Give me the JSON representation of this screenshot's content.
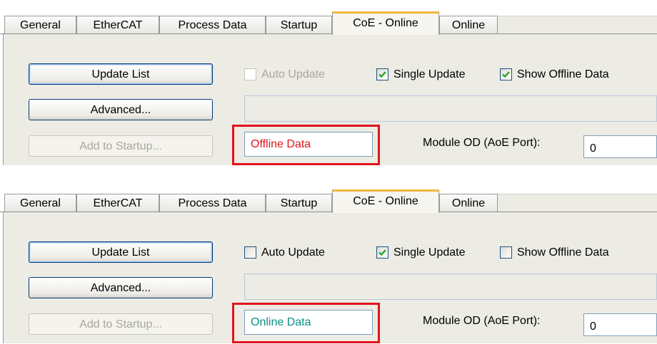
{
  "colors": {
    "offline_text": "#e0141c",
    "online_text": "#0a8c86",
    "highlight": "#e0141c",
    "active_tab_accent": "#f4b73d"
  },
  "panels": [
    {
      "tabs": [
        "General",
        "EtherCAT",
        "Process Data",
        "Startup",
        "CoE - Online",
        "Online"
      ],
      "active_tab": "CoE - Online",
      "buttons": {
        "update_list": "Update List",
        "advanced": "Advanced...",
        "add_to_startup": "Add to Startup..."
      },
      "checkboxes": {
        "auto_update": {
          "label": "Auto Update",
          "checked": false,
          "enabled": false
        },
        "single_update": {
          "label": "Single Update",
          "checked": true,
          "enabled": true
        },
        "show_offline_data": {
          "label": "Show Offline Data",
          "checked": true,
          "enabled": true
        }
      },
      "status_field": "Offline Data",
      "module_od_label": "Module OD (AoE Port):",
      "module_od_value": "0"
    },
    {
      "tabs": [
        "General",
        "EtherCAT",
        "Process Data",
        "Startup",
        "CoE - Online",
        "Online"
      ],
      "active_tab": "CoE - Online",
      "buttons": {
        "update_list": "Update List",
        "advanced": "Advanced...",
        "add_to_startup": "Add to Startup..."
      },
      "checkboxes": {
        "auto_update": {
          "label": "Auto Update",
          "checked": false,
          "enabled": true
        },
        "single_update": {
          "label": "Single Update",
          "checked": true,
          "enabled": true
        },
        "show_offline_data": {
          "label": "Show Offline Data",
          "checked": false,
          "enabled": true
        }
      },
      "status_field": "Online Data",
      "module_od_label": "Module OD (AoE Port):",
      "module_od_value": "0"
    }
  ]
}
